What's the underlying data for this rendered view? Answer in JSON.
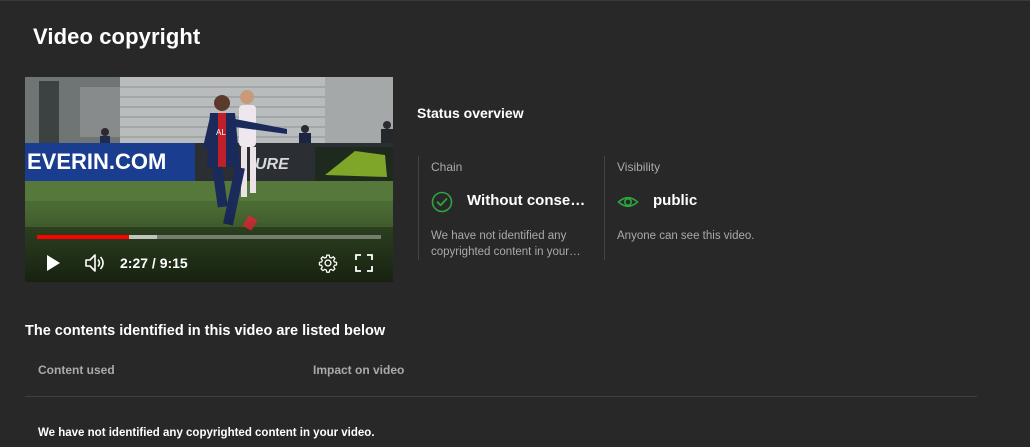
{
  "dialog": {
    "title": "Video copyright"
  },
  "player": {
    "banner_text": "EVERIN.COM",
    "banner_text_2": "URE",
    "jersey_text": "AL",
    "current_time": "2:27",
    "duration": "9:15",
    "time_display": "2:27 / 9:15",
    "progress_played_fraction": 0.268,
    "progress_buffered_fraction": 0.35,
    "icons": {
      "play": "play-icon",
      "volume": "volume-icon",
      "settings": "gear-icon",
      "fullscreen": "fullscreen-icon"
    }
  },
  "status": {
    "title": "Status overview",
    "chain": {
      "label": "Chain",
      "value": "Without consequences",
      "description": "We have not identified any copyrighted content in your video.",
      "icon": "check-circle-icon",
      "icon_color": "#2ba640"
    },
    "visibility": {
      "label": "Visibility",
      "value": "public",
      "description": "Anyone can see this video.",
      "icon": "eye-icon",
      "icon_color": "#2ba640"
    }
  },
  "contents": {
    "heading": "The contents identified in this video are listed below",
    "columns": [
      "Content used",
      "Impact on video"
    ],
    "empty_message": "We have not identified any copyrighted content in your video."
  },
  "colors": {
    "background": "#282828",
    "accent_red": "#ff0000",
    "success_green": "#2ba640"
  }
}
